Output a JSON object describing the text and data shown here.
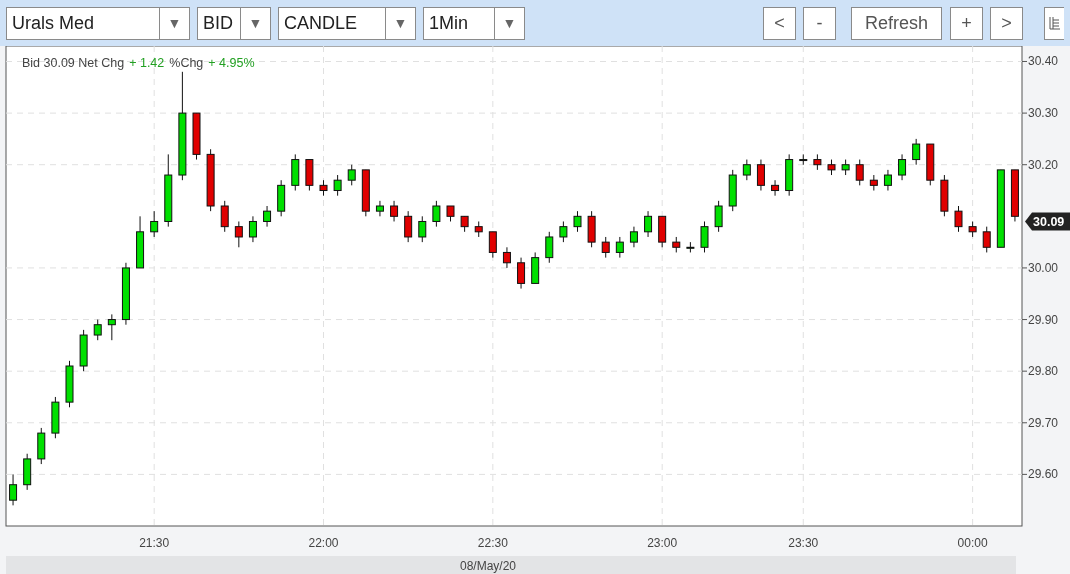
{
  "toolbar": {
    "selects": [
      {
        "value": "Urals Med",
        "arrow": "▼"
      },
      {
        "value": "BID",
        "arrow": "▼"
      },
      {
        "value": "CANDLE",
        "arrow": "▼"
      },
      {
        "value": "1Min",
        "arrow": "▼"
      }
    ],
    "buttons": [
      "<",
      "-",
      "Refresh",
      "+",
      ">"
    ]
  },
  "quote": {
    "bid_label": "Bid 30.09 Net Chg",
    "net_change": "+ 1.42",
    "pct_label": "%Chg",
    "pct_change": "+ 4.95%"
  },
  "last_price": "30.09",
  "date_label": "08/May/20",
  "chart_data": {
    "type": "candlestick",
    "yticks": [
      {
        "value": 29.6,
        "label": "29.60"
      },
      {
        "value": 29.7,
        "label": "29.70"
      },
      {
        "value": 29.8,
        "label": "29.80"
      },
      {
        "value": 29.9,
        "label": "29.90"
      },
      {
        "value": 30.0,
        "label": "30.00"
      },
      {
        "value": 30.2,
        "label": "30.20"
      },
      {
        "value": 30.3,
        "label": "30.30"
      },
      {
        "value": 30.4,
        "label": "30.40"
      }
    ],
    "ylim": [
      29.5,
      30.43
    ],
    "grid": true,
    "categories": [
      null,
      null,
      null,
      null,
      null,
      null,
      null,
      null,
      null,
      null,
      "21:30",
      null,
      null,
      null,
      null,
      null,
      null,
      null,
      null,
      null,
      null,
      null,
      "22:00",
      null,
      null,
      null,
      null,
      null,
      null,
      null,
      null,
      null,
      null,
      null,
      "22:30",
      null,
      null,
      null,
      null,
      null,
      null,
      null,
      null,
      null,
      null,
      null,
      "23:00",
      null,
      null,
      null,
      null,
      null,
      null,
      null,
      null,
      null,
      "23:30",
      null,
      null,
      null,
      null,
      null,
      null,
      null,
      null,
      null,
      null,
      null,
      "00:00",
      null,
      null,
      null
    ],
    "ohlc": [
      [
        29.55,
        29.6,
        29.54,
        29.58
      ],
      [
        29.58,
        29.64,
        29.57,
        29.63
      ],
      [
        29.63,
        29.69,
        29.62,
        29.68
      ],
      [
        29.68,
        29.75,
        29.67,
        29.74
      ],
      [
        29.74,
        29.82,
        29.73,
        29.81
      ],
      [
        29.81,
        29.88,
        29.8,
        29.87
      ],
      [
        29.87,
        29.9,
        29.86,
        29.89
      ],
      [
        29.89,
        29.91,
        29.86,
        29.9
      ],
      [
        29.9,
        30.01,
        29.89,
        30.0
      ],
      [
        30.0,
        30.1,
        30.0,
        30.07
      ],
      [
        30.07,
        30.11,
        30.06,
        30.09
      ],
      [
        30.09,
        30.22,
        30.08,
        30.18
      ],
      [
        30.18,
        30.38,
        30.17,
        30.3
      ],
      [
        30.3,
        30.3,
        30.21,
        30.22
      ],
      [
        30.22,
        30.23,
        30.11,
        30.12
      ],
      [
        30.12,
        30.13,
        30.07,
        30.08
      ],
      [
        30.08,
        30.09,
        30.04,
        30.06
      ],
      [
        30.06,
        30.1,
        30.05,
        30.09
      ],
      [
        30.09,
        30.12,
        30.08,
        30.11
      ],
      [
        30.11,
        30.17,
        30.1,
        30.16
      ],
      [
        30.16,
        30.22,
        30.15,
        30.21
      ],
      [
        30.21,
        30.21,
        30.15,
        30.16
      ],
      [
        30.16,
        30.17,
        30.14,
        30.15
      ],
      [
        30.15,
        30.18,
        30.14,
        30.17
      ],
      [
        30.17,
        30.2,
        30.16,
        30.19
      ],
      [
        30.19,
        30.19,
        30.1,
        30.11
      ],
      [
        30.11,
        30.13,
        30.1,
        30.12
      ],
      [
        30.12,
        30.13,
        30.09,
        30.1
      ],
      [
        30.1,
        30.11,
        30.05,
        30.06
      ],
      [
        30.06,
        30.1,
        30.05,
        30.09
      ],
      [
        30.09,
        30.13,
        30.08,
        30.12
      ],
      [
        30.12,
        30.12,
        30.09,
        30.1
      ],
      [
        30.1,
        30.1,
        30.07,
        30.08
      ],
      [
        30.08,
        30.09,
        30.06,
        30.07
      ],
      [
        30.07,
        30.07,
        30.02,
        30.03
      ],
      [
        30.03,
        30.04,
        30.0,
        30.01
      ],
      [
        30.01,
        30.02,
        29.96,
        29.97
      ],
      [
        29.97,
        30.03,
        29.97,
        30.02
      ],
      [
        30.02,
        30.07,
        30.01,
        30.06
      ],
      [
        30.06,
        30.09,
        30.05,
        30.08
      ],
      [
        30.08,
        30.11,
        30.07,
        30.1
      ],
      [
        30.1,
        30.11,
        30.04,
        30.05
      ],
      [
        30.05,
        30.06,
        30.02,
        30.03
      ],
      [
        30.03,
        30.06,
        30.02,
        30.05
      ],
      [
        30.05,
        30.08,
        30.04,
        30.07
      ],
      [
        30.07,
        30.11,
        30.06,
        30.1
      ],
      [
        30.1,
        30.1,
        30.04,
        30.05
      ],
      [
        30.05,
        30.06,
        30.03,
        30.04
      ],
      [
        30.04,
        30.05,
        30.03,
        30.04
      ],
      [
        30.04,
        30.09,
        30.03,
        30.08
      ],
      [
        30.08,
        30.13,
        30.07,
        30.12
      ],
      [
        30.12,
        30.19,
        30.11,
        30.18
      ],
      [
        30.18,
        30.21,
        30.17,
        30.2
      ],
      [
        30.2,
        30.21,
        30.15,
        30.16
      ],
      [
        30.16,
        30.17,
        30.14,
        30.15
      ],
      [
        30.15,
        30.22,
        30.14,
        30.21
      ],
      [
        30.21,
        30.22,
        30.2,
        30.21
      ],
      [
        30.21,
        30.22,
        30.19,
        30.2
      ],
      [
        30.2,
        30.21,
        30.18,
        30.19
      ],
      [
        30.19,
        30.21,
        30.18,
        30.2
      ],
      [
        30.2,
        30.21,
        30.16,
        30.17
      ],
      [
        30.17,
        30.18,
        30.15,
        30.16
      ],
      [
        30.16,
        30.19,
        30.15,
        30.18
      ],
      [
        30.18,
        30.22,
        30.17,
        30.21
      ],
      [
        30.21,
        30.25,
        30.2,
        30.24
      ],
      [
        30.24,
        30.24,
        30.16,
        30.17
      ],
      [
        30.17,
        30.18,
        30.1,
        30.11
      ],
      [
        30.11,
        30.12,
        30.07,
        30.08
      ],
      [
        30.08,
        30.09,
        30.06,
        30.07
      ],
      [
        30.07,
        30.08,
        30.03,
        30.04
      ],
      [
        30.04,
        30.19,
        30.04,
        30.19
      ],
      [
        30.19,
        30.19,
        30.09,
        30.1
      ]
    ]
  }
}
